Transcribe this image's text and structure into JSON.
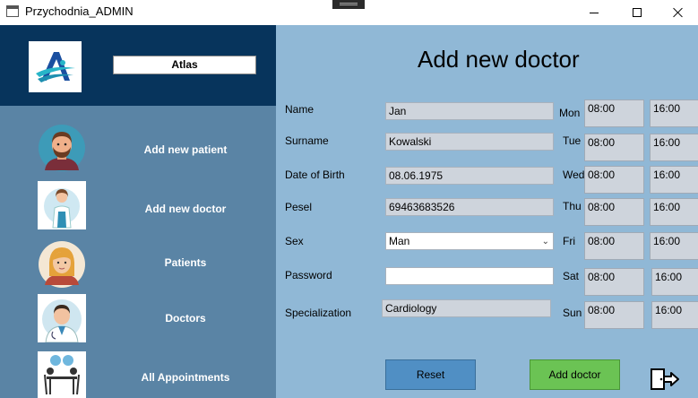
{
  "window": {
    "title": "Przychodnia_ADMIN"
  },
  "sidebar": {
    "clinic_name": "Atlas",
    "items": [
      {
        "label": "Add new patient"
      },
      {
        "label": "Add new doctor"
      },
      {
        "label": "Patients"
      },
      {
        "label": "Doctors"
      },
      {
        "label": "All Appointments"
      }
    ]
  },
  "form": {
    "title": "Add new doctor",
    "fields": {
      "name": {
        "label": "Name",
        "value": "Jan"
      },
      "surname": {
        "label": "Surname",
        "value": "Kowalski"
      },
      "dob": {
        "label": "Date of Birth",
        "value": "08.06.1975"
      },
      "pesel": {
        "label": "Pesel",
        "value": "69463683526"
      },
      "sex": {
        "label": "Sex",
        "value": "Man"
      },
      "password": {
        "label": "Password",
        "value": ""
      },
      "specialization": {
        "label": "Specialization",
        "value": "Cardiology"
      }
    },
    "schedule": [
      {
        "day": "Mon",
        "start": "08:00",
        "end": "16:00"
      },
      {
        "day": "Tue",
        "start": "08:00",
        "end": "16:00"
      },
      {
        "day": "Wed",
        "start": "08:00",
        "end": "16:00"
      },
      {
        "day": "Thu",
        "start": "08:00",
        "end": "16:00"
      },
      {
        "day": "Fri",
        "start": "08:00",
        "end": "16:00"
      },
      {
        "day": "Sat",
        "start": "08:00",
        "end": "16:00"
      },
      {
        "day": "Sun",
        "start": "08:00",
        "end": "16:00"
      }
    ],
    "reset_label": "Reset",
    "add_label": "Add doctor"
  },
  "colors": {
    "sidebar_header": "#07345c",
    "sidebar_bg": "#5a84a5",
    "main_bg": "#90b8d6",
    "reset_button": "#508fc4",
    "add_button": "#6bc354"
  },
  "icons": {
    "app": "window-icon",
    "logo": "atlas-logo",
    "logout": "logout-door-icon"
  }
}
